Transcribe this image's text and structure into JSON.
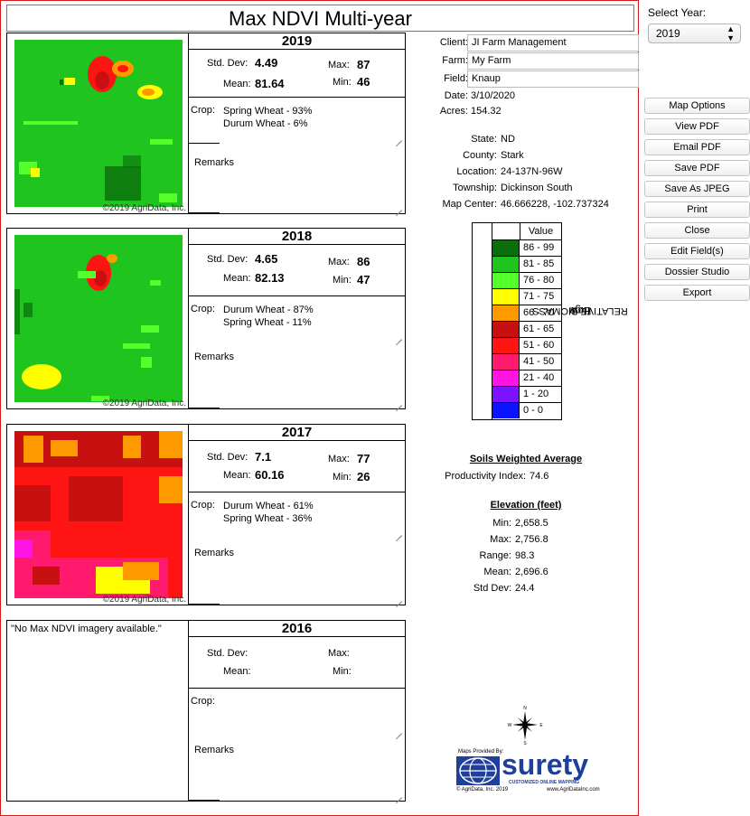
{
  "report": {
    "title": "Max NDVI Multi-year",
    "copyright": "©2019 AgriData, Inc."
  },
  "stat_labels": {
    "std_dev": "Std. Dev:",
    "max": "Max:",
    "mean": "Mean:",
    "min": "Min:",
    "crop": "Crop:",
    "remarks": "Remarks"
  },
  "panels": [
    {
      "year": "2019",
      "std_dev": "4.49",
      "max": "87",
      "mean": "81.64",
      "min": "46",
      "crops": [
        "Spring Wheat - 93%",
        "Durum Wheat - 6%"
      ]
    },
    {
      "year": "2018",
      "std_dev": "4.65",
      "max": "86",
      "mean": "82.13",
      "min": "47",
      "crops": [
        "Durum Wheat - 87%",
        "Spring Wheat - 11%"
      ]
    },
    {
      "year": "2017",
      "std_dev": "7.1",
      "max": "77",
      "mean": "60.16",
      "min": "26",
      "crops": [
        "Durum Wheat - 61%",
        "Spring Wheat - 36%"
      ]
    },
    {
      "year": "2016",
      "std_dev": "",
      "max": "",
      "mean": "",
      "min": "",
      "crops": [
        "",
        ""
      ],
      "no_imagery": "\"No Max NDVI imagery available.\""
    }
  ],
  "info": {
    "client_label": "Client:",
    "client": "JI Farm Management",
    "farm_label": "Farm:",
    "farm": "My Farm",
    "field_label": "Field:",
    "field": "Knaup",
    "date_label": "Date:",
    "date": "3/10/2020",
    "acres_label": "Acres:",
    "acres": "154.32"
  },
  "location": {
    "state_label": "State:",
    "state": "ND",
    "county_label": "County:",
    "county": "Stark",
    "location_label": "Location:",
    "location": "24-137N-96W",
    "township_label": "Township:",
    "township": "Dickinson South",
    "center_label": "Map Center:",
    "center": "46.666228, -102.737324"
  },
  "legend": {
    "header": "Value",
    "vertical_low": "Low",
    "vertical_mid": "RELATIVE BIOMASS",
    "vertical_high": "High",
    "rows": [
      {
        "range": "86 - 99",
        "color": "#0a6e0a"
      },
      {
        "range": "81 - 85",
        "color": "#1fc41f"
      },
      {
        "range": "76 - 80",
        "color": "#55ff2a"
      },
      {
        "range": "71 - 75",
        "color": "#ffff00"
      },
      {
        "range": "66 - 70",
        "color": "#ff9900"
      },
      {
        "range": "61 - 65",
        "color": "#c81010"
      },
      {
        "range": "51 - 60",
        "color": "#ff1414"
      },
      {
        "range": "41 - 50",
        "color": "#ff1a6e"
      },
      {
        "range": "21 - 40",
        "color": "#ff14e6"
      },
      {
        "range": "1 - 20",
        "color": "#7a14ff"
      },
      {
        "range": "0 - 0",
        "color": "#0a14ff"
      }
    ]
  },
  "soils": {
    "heading": "Soils Weighted Average",
    "pi_label": "Productivity Index:",
    "pi": "74.6"
  },
  "elevation": {
    "heading": "Elevation (feet)",
    "min_label": "Min:",
    "min": "2,658.5",
    "max_label": "Max:",
    "max": "2,756.8",
    "range_label": "Range:",
    "range": "98.3",
    "mean_label": "Mean:",
    "mean": "2,696.6",
    "sd_label": "Std Dev:",
    "sd": "24.4"
  },
  "compass": {
    "n": "N",
    "s": "S",
    "e": "E",
    "w": "W"
  },
  "logo": {
    "provided": "Maps Provided By:",
    "brand": "surety",
    "tagline": "CUSTOMIZED ONLINE MAPPING",
    "copyright": "© AgriData, Inc. 2019",
    "url": "www.AgriDataInc.com"
  },
  "sidebar": {
    "select_label": "Select Year:",
    "selected_year": "2019",
    "buttons": [
      "Map Options",
      "View PDF",
      "Email PDF",
      "Save PDF",
      "Save As JPEG",
      "Print",
      "Close",
      "Edit Field(s)",
      "Dossier Studio",
      "Export"
    ]
  }
}
